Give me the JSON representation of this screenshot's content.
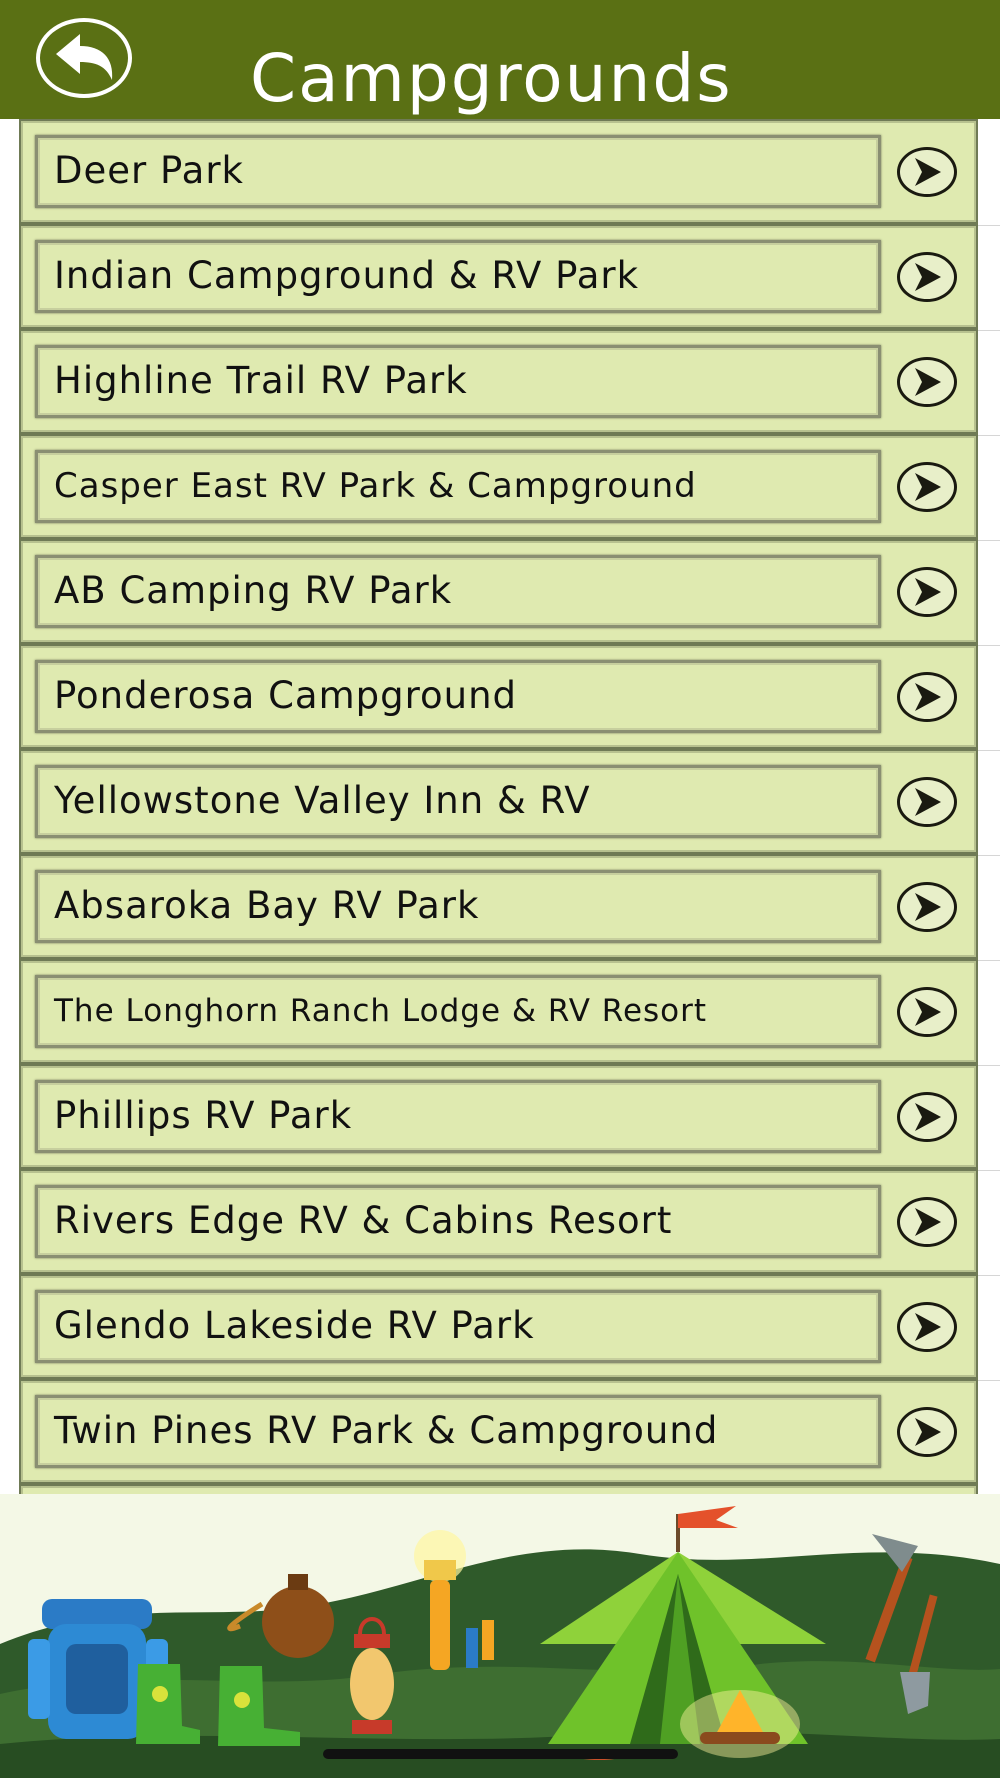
{
  "header": {
    "title": "Campgrounds",
    "back_icon": "back-arrow-icon"
  },
  "campgrounds": [
    {
      "name": "Deer Park"
    },
    {
      "name": "Indian Campground & RV Park"
    },
    {
      "name": "Highline Trail RV Park"
    },
    {
      "name": "Casper East RV Park & Campground"
    },
    {
      "name": "AB Camping RV Park"
    },
    {
      "name": "Ponderosa Campground"
    },
    {
      "name": "Yellowstone Valley Inn & RV"
    },
    {
      "name": "Absaroka Bay RV Park"
    },
    {
      "name": "The Longhorn Ranch Lodge & RV Resort"
    },
    {
      "name": "Phillips RV Park"
    },
    {
      "name": "Rivers Edge RV & Cabins Resort"
    },
    {
      "name": "Glendo Lakeside RV Park"
    },
    {
      "name": "Twin Pines RV Park & Campground"
    }
  ],
  "row_icon": "chevron-right-circle-icon",
  "colors": {
    "header_bg": "#5a7014",
    "row_bg": "#dfeab0",
    "tent_green": "#6fc22a"
  }
}
